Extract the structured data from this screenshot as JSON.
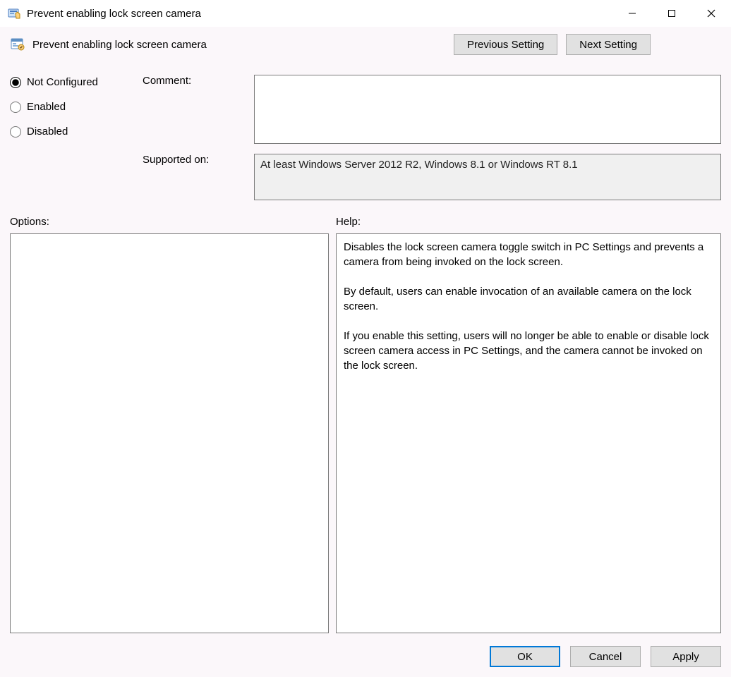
{
  "window": {
    "title": "Prevent enabling lock screen camera"
  },
  "header": {
    "policy_title": "Prevent enabling lock screen camera",
    "previous_label": "Previous Setting",
    "next_label": "Next Setting"
  },
  "state": {
    "radios": {
      "not_configured": "Not Configured",
      "enabled": "Enabled",
      "disabled": "Disabled",
      "selected": "not_configured"
    },
    "comment_label": "Comment:",
    "comment_value": "",
    "supported_label": "Supported on:",
    "supported_value": "At least Windows Server 2012 R2, Windows 8.1 or Windows RT 8.1"
  },
  "panes": {
    "options_label": "Options:",
    "help_label": "Help:",
    "help_text": "Disables the lock screen camera toggle switch in PC Settings and prevents a camera from being invoked on the lock screen.\n\nBy default, users can enable invocation of an available camera on the lock screen.\n\nIf you enable this setting, users will no longer be able to enable or disable lock screen camera access in PC Settings, and the camera cannot be invoked on the lock screen."
  },
  "footer": {
    "ok": "OK",
    "cancel": "Cancel",
    "apply": "Apply"
  }
}
